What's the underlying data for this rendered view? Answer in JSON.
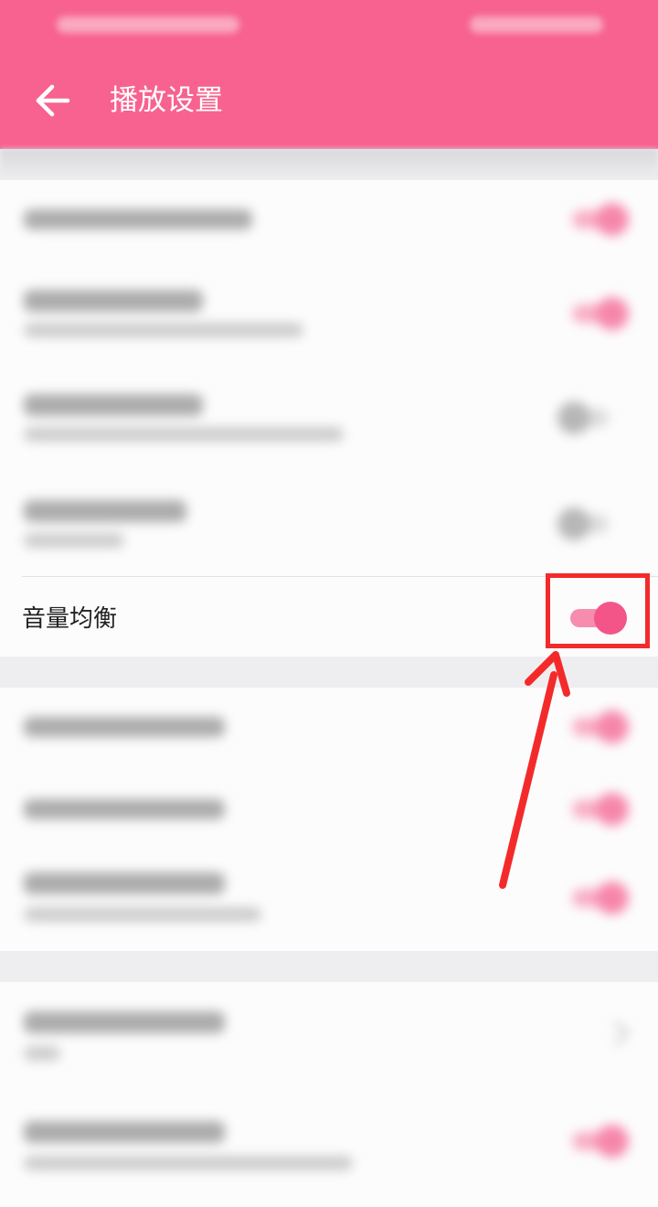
{
  "header": {
    "title": "播放设置",
    "back_icon": "arrow-left-icon",
    "background": "#f76290"
  },
  "settings": {
    "volume_balance": {
      "label": "音量均衡",
      "toggle_on": true
    }
  },
  "colors": {
    "toggle_on": "#f45589",
    "highlight": "#f42a2a"
  }
}
